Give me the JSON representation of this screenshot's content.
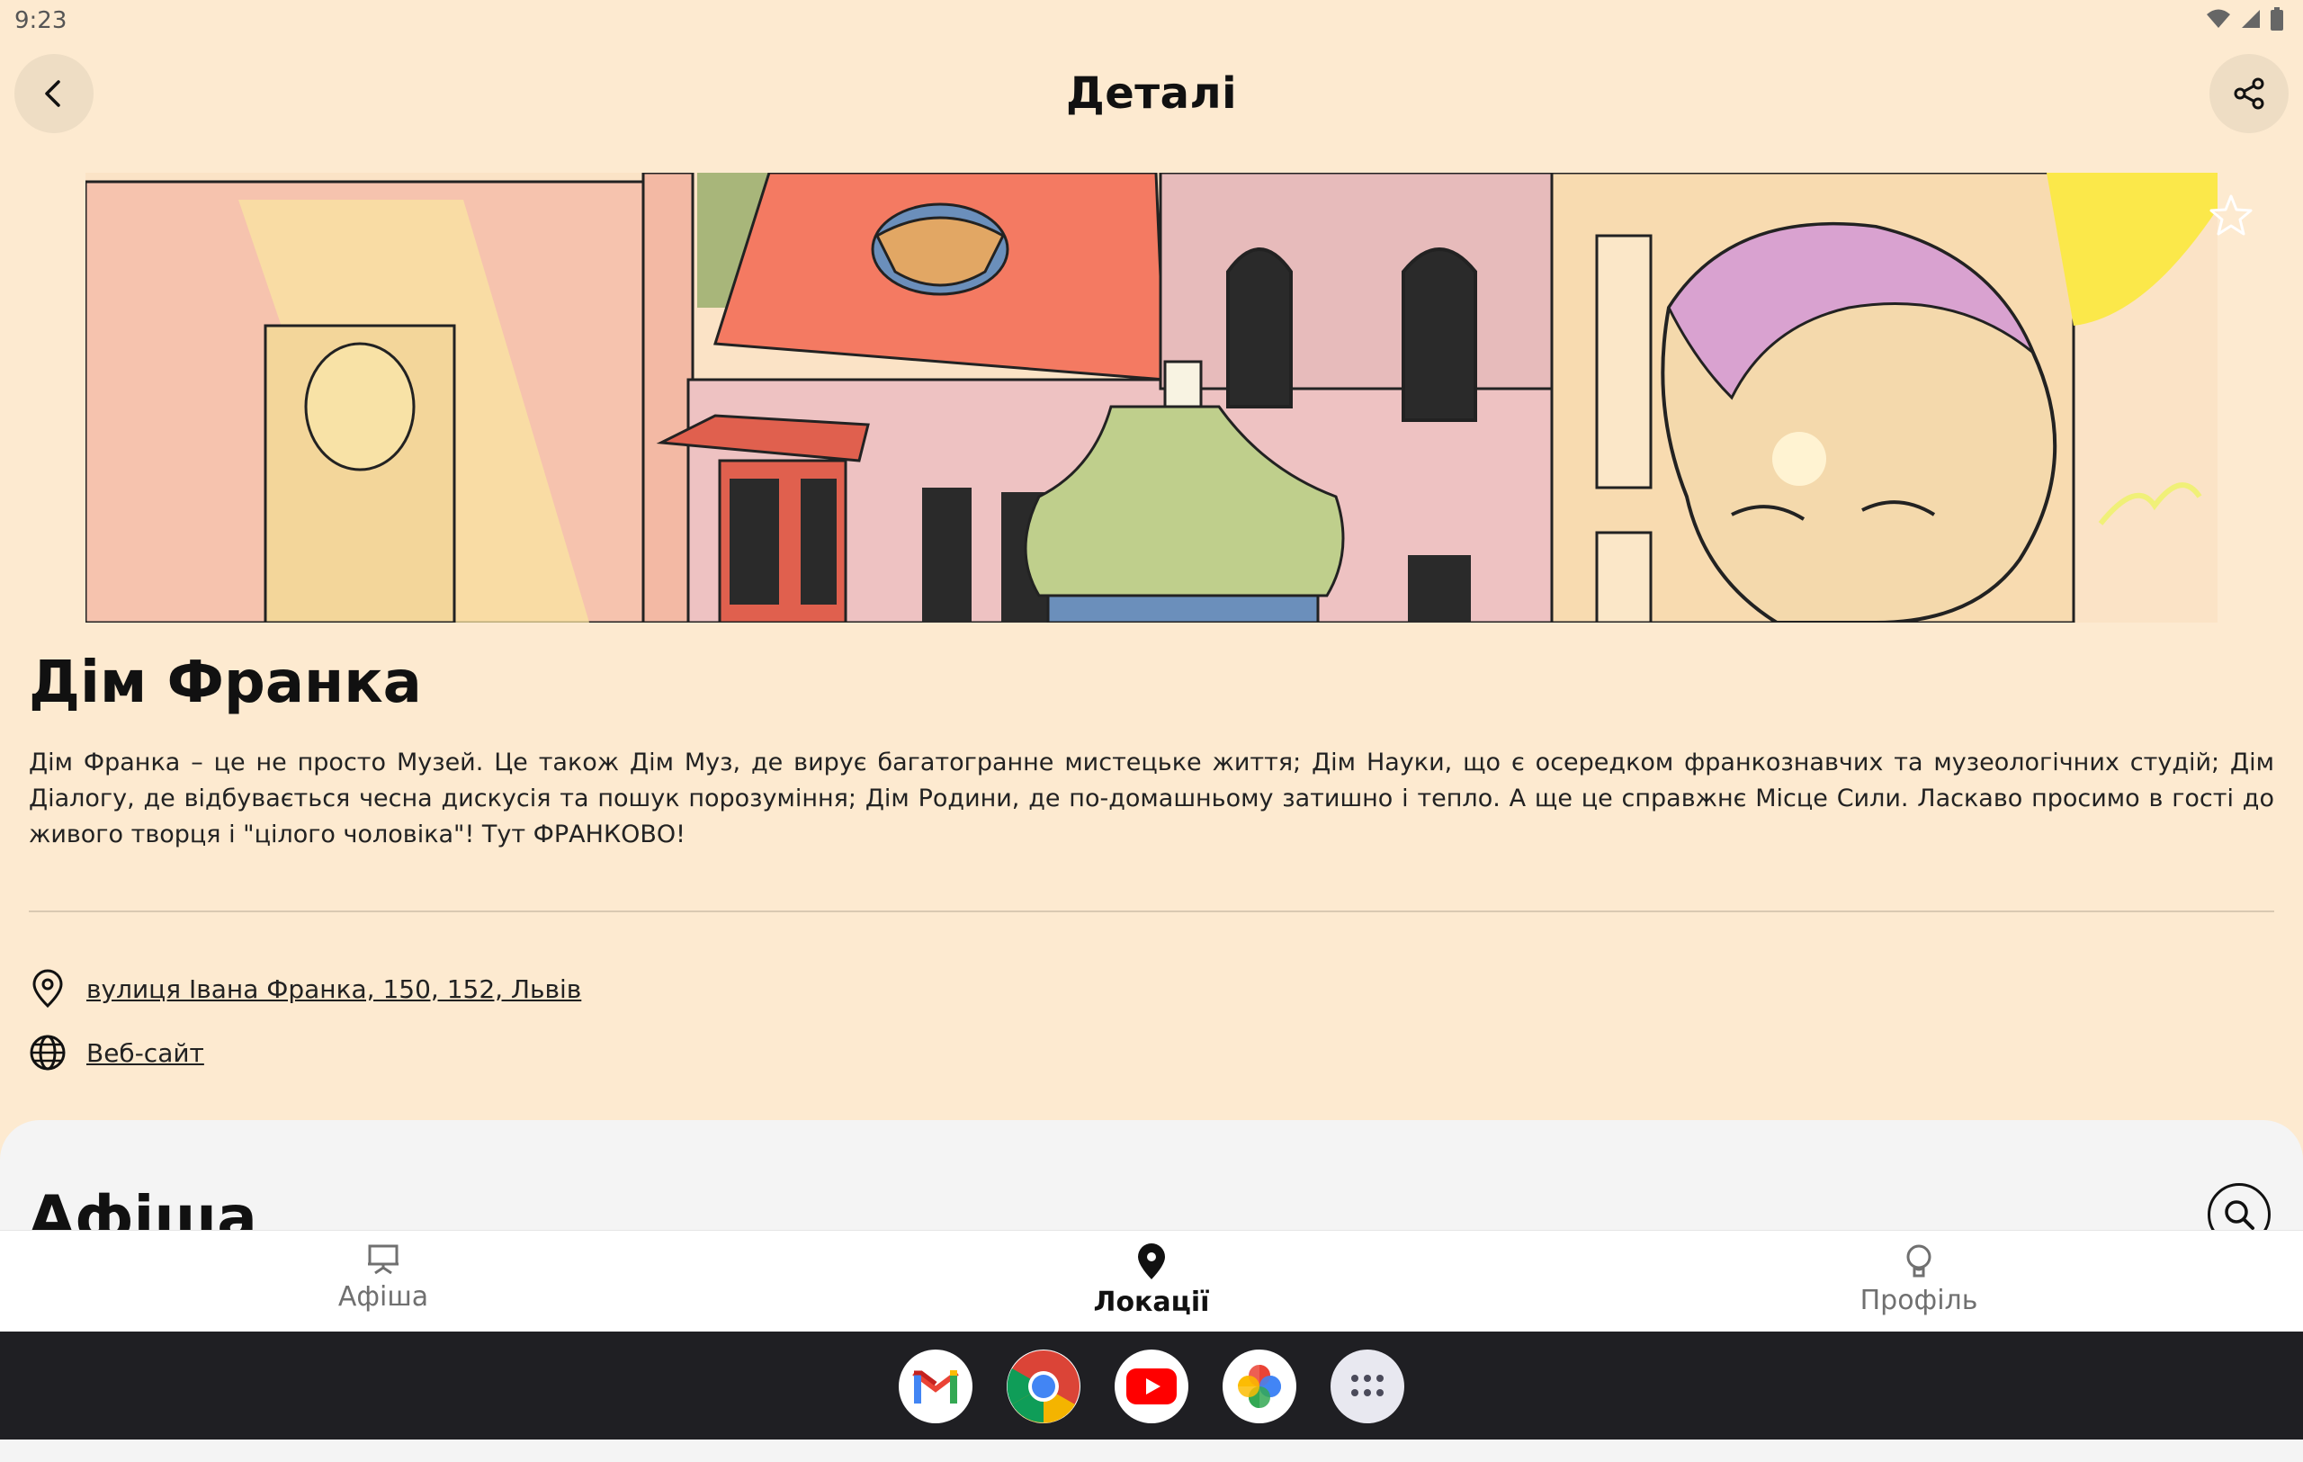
{
  "status": {
    "time": "9:23"
  },
  "header": {
    "title": "Деталі"
  },
  "place": {
    "name": "Дім Франка",
    "description": "Дім Франка – це не просто Музей. Це також Дім Муз, де вирує багатогранне мистецьке життя; Дім Науки, що є осередком франкознавчих та музеологічних студій; Дім Діалогу, де відбувається чесна дискусія та пошук порозуміння; Дім Родини, де по-домашньому затишно і тепло. А ще це справжнє Місце Сили. Ласкаво просимо в гості до живого творця і \"цілого чоловіка\"! Тут ФРАНКОВО!",
    "address": "вулиця Івана Франка, 150, 152, Львів",
    "website_label": "Веб-сайт"
  },
  "events": {
    "title": "Афіша"
  },
  "nav": {
    "items": [
      {
        "label": "Афіша",
        "icon": "easel-icon",
        "active": false
      },
      {
        "label": "Локації",
        "icon": "location-pin-icon",
        "active": true
      },
      {
        "label": "Профіль",
        "icon": "profile-icon",
        "active": false
      }
    ]
  },
  "dock": {
    "apps": [
      "gmail-icon",
      "chrome-icon",
      "youtube-icon",
      "photos-icon",
      "app-drawer-icon"
    ]
  },
  "colors": {
    "background": "#fdead0",
    "button_bg": "#eeddc4",
    "sheet_bg": "#f4f4f4"
  }
}
